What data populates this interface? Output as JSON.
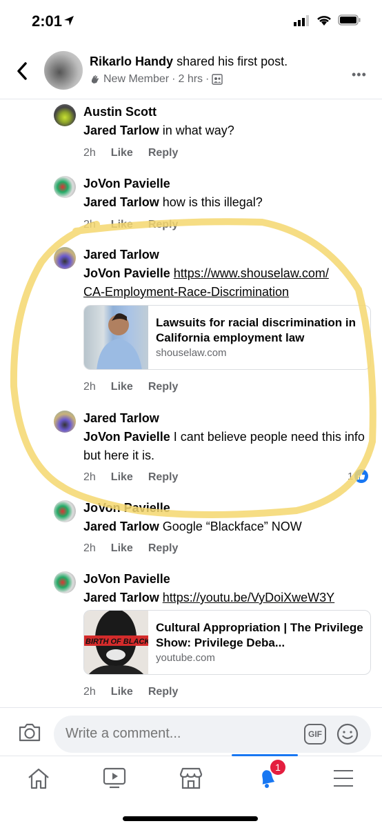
{
  "status_bar": {
    "time": "2:01",
    "location_icon": "location-arrow-icon",
    "signal_icon": "cellular-signal-icon",
    "wifi_icon": "wifi-icon",
    "battery_icon": "battery-icon"
  },
  "header": {
    "author": "Rikarlo Handy",
    "action": "shared his first post.",
    "badge": "New Member",
    "time": "2 hrs",
    "sep": "·",
    "badge_icon": "waving-hand-icon",
    "audience_icon": "group-members-icon",
    "more_label": "•••"
  },
  "comments": [
    {
      "author": "Austin Scott",
      "mention": "Jared Tarlow",
      "text": "in what way?",
      "time": "2h",
      "like": "Like",
      "reply": "Reply"
    },
    {
      "author": "JoVon Pavielle",
      "mention": "Jared Tarlow",
      "text": "how is this illegal?",
      "time": "2h",
      "like": "Like",
      "reply": "Reply"
    },
    {
      "author": "Jared Tarlow",
      "mention": "JoVon Pavielle",
      "link": "https://www.shouselaw.com/CA-Employment-Race-Discrimination",
      "link_line1": "https://www.shouselaw.com/",
      "link_line2": "CA-Employment-Race-Discrimination",
      "time": "2h",
      "like": "Like",
      "reply": "Reply",
      "preview": {
        "title": "Lawsuits for racial discrimination in California employment law",
        "domain": "shouselaw.com"
      }
    },
    {
      "author": "Jared Tarlow",
      "mention": "JoVon Pavielle",
      "text": "I cant believe people need this info but here it is.",
      "time": "2h",
      "like": "Like",
      "reply": "Reply",
      "reaction_count": "1"
    },
    {
      "author": "JoVon Pavielle",
      "mention": "Jared Tarlow",
      "text": "Google “Blackface” NOW",
      "time": "2h",
      "like": "Like",
      "reply": "Reply"
    },
    {
      "author": "JoVon Pavielle",
      "mention": "Jared Tarlow",
      "link": "https://youtu.be/VyDoiXweW3Y",
      "time": "2h",
      "like": "Like",
      "reply": "Reply",
      "preview": {
        "title": "Cultural Appropriation | The Privilege Show: Privilege Deba...",
        "domain": "youtube.com",
        "thumb_text": "BIRTH OF BLACK"
      }
    }
  ],
  "composer": {
    "placeholder": "Write a comment...",
    "gif_label": "GIF"
  },
  "tabbar": {
    "notification_badge": "1",
    "active_tab": "notifications"
  },
  "colors": {
    "accent": "#1877f2",
    "badge": "#e41e3f",
    "highlight": "#f5d76e",
    "secondary_text": "#65676b"
  }
}
